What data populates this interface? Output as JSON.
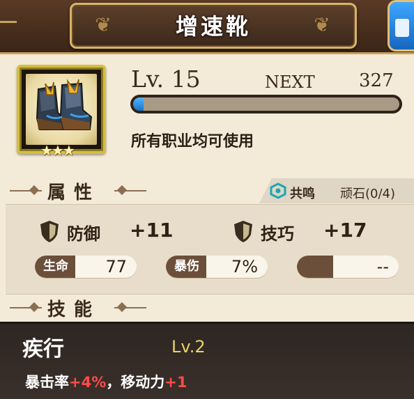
{
  "item": {
    "title": "增速靴",
    "rarity_stars": 3,
    "level_label": "Lv. 15",
    "next_label": "NEXT",
    "next_value": "327",
    "exp_progress": 0.04,
    "usable_text": "所有职业均可使用"
  },
  "sections": {
    "attributes_label": "属性",
    "skills_label": "技能"
  },
  "resonance": {
    "icon": "resonance-icon",
    "label": "共鸣",
    "value": "顽石(0/4)"
  },
  "stats": [
    {
      "icon": "shield-icon",
      "name": "防御",
      "value": "+11"
    },
    {
      "icon": "shield-icon",
      "name": "技巧",
      "value": "+17"
    }
  ],
  "sub_stats": [
    {
      "tag": "生命",
      "value": "77"
    },
    {
      "tag": "暴伤",
      "value": "7%"
    },
    {
      "tag": "",
      "value": "--"
    }
  ],
  "skill": {
    "name": "疾行",
    "level": "Lv.2",
    "desc_parts": [
      {
        "text": "暴击率",
        "highlight": false
      },
      {
        "text": "+4%",
        "highlight": true
      },
      {
        "text": "，移动力",
        "highlight": false
      },
      {
        "text": "+1",
        "highlight": true
      }
    ]
  },
  "colors": {
    "highlight_red": "#ff4a4a",
    "exp_blue": "#2a8ff0",
    "skill_level_gold": "#e7d36a"
  }
}
